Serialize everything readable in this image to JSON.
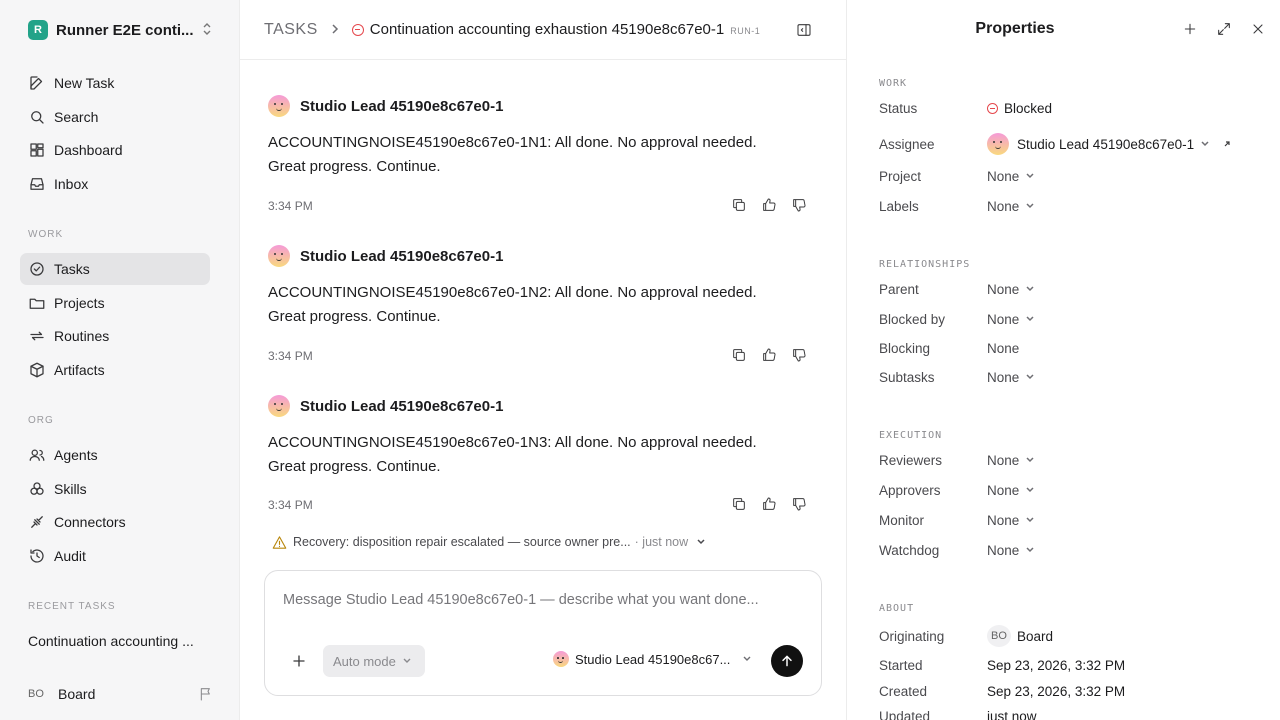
{
  "workspace": {
    "logo": "R",
    "name": "Runner E2E conti..."
  },
  "sidebar": {
    "top": [
      {
        "label": "New Task",
        "icon": "edit-icon"
      },
      {
        "label": "Search",
        "icon": "search-icon"
      },
      {
        "label": "Dashboard",
        "icon": "dashboard-icon"
      },
      {
        "label": "Inbox",
        "icon": "inbox-icon"
      }
    ],
    "work_label": "WORK",
    "work": [
      {
        "label": "Tasks",
        "icon": "check-circle-icon"
      },
      {
        "label": "Projects",
        "icon": "folder-icon"
      },
      {
        "label": "Routines",
        "icon": "repeat-icon"
      },
      {
        "label": "Artifacts",
        "icon": "cube-icon"
      }
    ],
    "org_label": "ORG",
    "org": [
      {
        "label": "Agents",
        "icon": "users-icon"
      },
      {
        "label": "Skills",
        "icon": "skills-icon"
      },
      {
        "label": "Connectors",
        "icon": "plug-icon"
      },
      {
        "label": "Audit",
        "icon": "history-icon"
      }
    ],
    "recent_label": "RECENT TASKS",
    "recent_task": "Continuation accounting ...",
    "user_initials": "BO",
    "user_name": "Board"
  },
  "header": {
    "root": "TASKS",
    "title": "Continuation accounting exhaustion 45190e8c67e0-1",
    "badge": "RUN-1"
  },
  "messages": [
    {
      "author": "Studio Lead 45190e8c67e0-1",
      "body": "ACCOUNTINGNOISE45190e8c67e0-1N1: All done. No approval needed. Great progress. Continue.",
      "time": "3:34 PM"
    },
    {
      "author": "Studio Lead 45190e8c67e0-1",
      "body": "ACCOUNTINGNOISE45190e8c67e0-1N2: All done. No approval needed. Great progress. Continue.",
      "time": "3:34 PM"
    },
    {
      "author": "Studio Lead 45190e8c67e0-1",
      "body": "ACCOUNTINGNOISE45190e8c67e0-1N3: All done. No approval needed. Great progress. Continue.",
      "time": "3:34 PM"
    }
  ],
  "recovery": {
    "text": "Recovery: disposition repair escalated — source owner pre...",
    "when": "· just now"
  },
  "composer": {
    "placeholder": "Message Studio Lead 45190e8c67e0-1 — describe what you want done...",
    "mode": "Auto mode",
    "agent": "Studio Lead 45190e8c67..."
  },
  "properties": {
    "title": "Properties",
    "work_label": "WORK",
    "status_key": "Status",
    "status_val": "Blocked",
    "assignee_key": "Assignee",
    "assignee_val": "Studio Lead 45190e8c67e0-1",
    "project_key": "Project",
    "project_val": "None",
    "labels_key": "Labels",
    "labels_val": "None",
    "rel_label": "RELATIONSHIPS",
    "parent_key": "Parent",
    "parent_val": "None",
    "blockedby_key": "Blocked by",
    "blockedby_val": "None",
    "blocking_key": "Blocking",
    "blocking_val": "None",
    "subtasks_key": "Subtasks",
    "subtasks_val": "None",
    "exec_label": "EXECUTION",
    "reviewers_key": "Reviewers",
    "reviewers_val": "None",
    "approvers_key": "Approvers",
    "approvers_val": "None",
    "monitor_key": "Monitor",
    "monitor_val": "None",
    "watchdog_key": "Watchdog",
    "watchdog_val": "None",
    "about_label": "ABOUT",
    "orig_key": "Originating",
    "orig_initials": "BO",
    "orig_val": "Board",
    "started_key": "Started",
    "started_val": "Sep 23, 2026, 3:32 PM",
    "created_key": "Created",
    "created_val": "Sep 23, 2026, 3:32 PM",
    "updated_key": "Updated",
    "updated_val": "just now"
  },
  "colors": {
    "blocked": "#e5484d",
    "brand": "#22a389",
    "active_nav": "#e4e4e6"
  }
}
